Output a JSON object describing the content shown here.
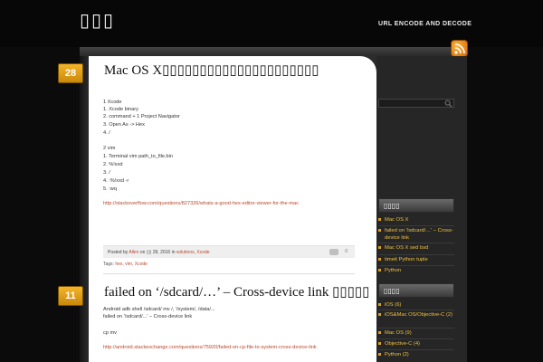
{
  "site": {
    "title": "▯▯▯",
    "tagline": "URL ENCODE AND DECODE"
  },
  "posts": [
    {
      "date": "28",
      "title": "Mac OS X▯▯▯▯▯▯▯▯▯▯▯▯▯▯▯▯▯▯▯▯▯",
      "body": [
        "1 Xcode",
        "1.    Xcode         binary",
        "2. command + 1   Project Navigator",
        "3.          Open As -> Hex",
        "4.    /",
        "",
        "2 vim",
        "1.    Terminal    vim path_to_file.bin",
        "2.  %!xxd",
        "3.    /",
        "4.  :%!xxd -r",
        "5.  :wq"
      ],
      "link": "http://stackoverflow.com/questions/827326/whats-a-good-hex-editor-viewer-for-the-mac",
      "meta": {
        "prefix": "Posted by",
        "author": "Allen",
        "on": "on ▯▯ 28, 2016 in",
        "cats": "solutions, Xcode",
        "comments": "0"
      },
      "tags_label": "Tags:",
      "tags": "hex, vim, Xcode"
    },
    {
      "date": "11",
      "title": "failed on ‘/sdcard/…’ – Cross-device link ▯▯▯▯▯",
      "body": [
        "Android adb shell /sdcard/  mv    /, '/system/, /data/...",
        "failed on '/sdcard/...' – Cross-device link",
        "",
        "    cp   mv"
      ],
      "link": "http://android.stackexchange.com/questions/75920/failed-on-cp-file-to-system-cross-device-link"
    }
  ],
  "sidebar": {
    "search_placeholder": "",
    "recent": {
      "heading": "▯▯▯▯",
      "items": [
        "Mac OS X",
        "failed on '/sdcard/…' – Cross-device link",
        "Mac OS X sed      bsd",
        "timeit   Python tuple",
        "Python"
      ]
    },
    "categories": {
      "heading": "▯▯▯▯",
      "items": [
        "iOS (6)",
        "iOS&Mac OS/Objective-C (2)",
        "Mac OS (9)",
        "Objective-C (4)",
        "Python (2)"
      ]
    }
  },
  "colors": {
    "accent": "#f0c040",
    "badge": "#e3a219",
    "link": "#b8472a"
  }
}
